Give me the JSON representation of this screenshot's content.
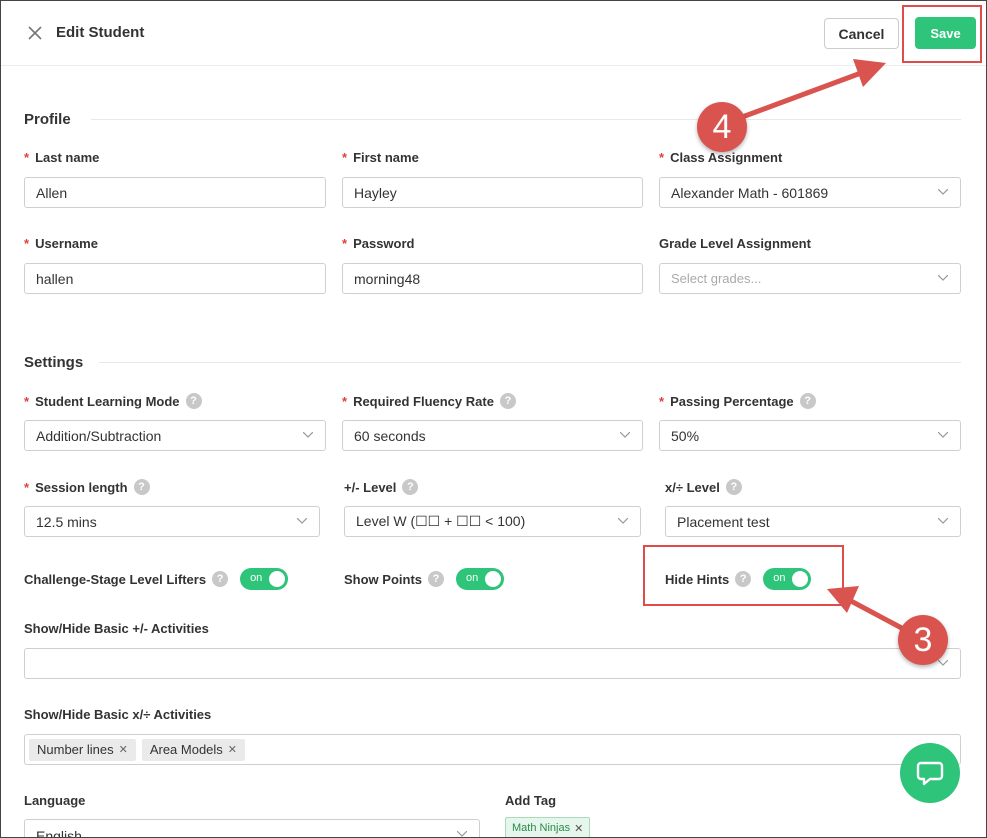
{
  "header": {
    "title": "Edit Student",
    "cancel_label": "Cancel",
    "save_label": "Save"
  },
  "profile": {
    "section_title": "Profile",
    "last_name": {
      "label": "Last name",
      "value": "Allen"
    },
    "first_name": {
      "label": "First name",
      "value": "Hayley"
    },
    "class_assignment": {
      "label": "Class Assignment",
      "value": "Alexander Math - 601869"
    },
    "username": {
      "label": "Username",
      "value": "hallen"
    },
    "password": {
      "label": "Password",
      "value": "morning48"
    },
    "grade_level": {
      "label": "Grade Level Assignment",
      "placeholder": "Select grades..."
    }
  },
  "settings": {
    "section_title": "Settings",
    "learning_mode": {
      "label": "Student Learning Mode",
      "value": "Addition/Subtraction"
    },
    "fluency_rate": {
      "label": "Required Fluency Rate",
      "value": "60 seconds"
    },
    "passing_percentage": {
      "label": "Passing Percentage",
      "value": "50%"
    },
    "session_length": {
      "label": "Session length",
      "value": "12.5 mins"
    },
    "add_sub_level": {
      "label": "+/- Level",
      "value": "Level W (☐☐ + ☐☐ < 100)"
    },
    "mul_div_level": {
      "label": "x/÷ Level",
      "value": "Placement test"
    },
    "challenge_lifters": {
      "label": "Challenge-Stage Level Lifters",
      "toggle": "on"
    },
    "show_points": {
      "label": "Show Points",
      "toggle": "on"
    },
    "hide_hints": {
      "label": "Hide Hints",
      "toggle": "on"
    },
    "basic_add_sub": {
      "label": "Show/Hide Basic +/- Activities"
    },
    "basic_mul_div": {
      "label": "Show/Hide Basic x/÷ Activities",
      "chips": [
        "Number lines",
        "Area Models"
      ]
    },
    "language": {
      "label": "Language",
      "value": "English"
    },
    "add_tag": {
      "label": "Add Tag",
      "tags": [
        "Math Ninjas"
      ]
    }
  },
  "annotations": {
    "step_save": "4",
    "step_hide_hints": "3"
  },
  "colors": {
    "accent": "#2ec47a",
    "required": "#e0403a",
    "annotation": "#e04b4b"
  }
}
